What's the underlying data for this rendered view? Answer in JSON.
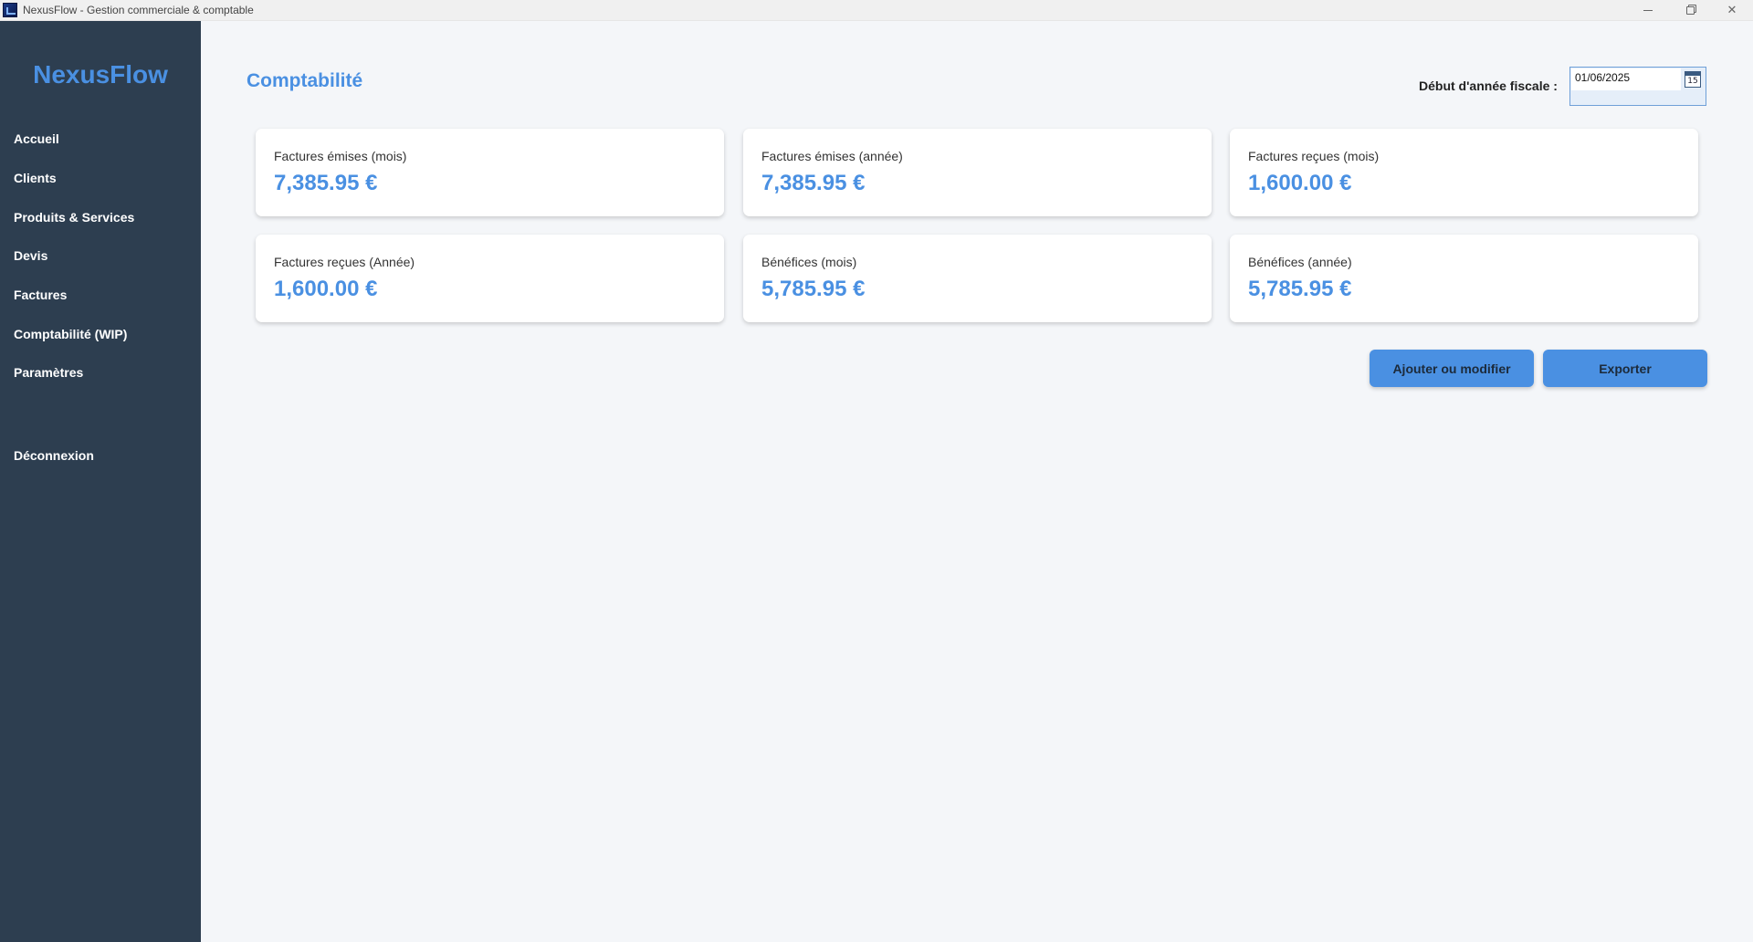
{
  "window": {
    "title": "NexusFlow - Gestion commerciale & comptable",
    "minimize_icon": "minimize-icon",
    "maximize_icon": "restore-icon",
    "close_glyph": "✕"
  },
  "sidebar": {
    "brand": "NexusFlow",
    "items": [
      {
        "label": "Accueil"
      },
      {
        "label": "Clients"
      },
      {
        "label": "Produits & Services"
      },
      {
        "label": "Devis"
      },
      {
        "label": "Factures"
      },
      {
        "label": "Comptabilité (WIP)"
      },
      {
        "label": "Paramètres"
      }
    ],
    "logout": "Déconnexion"
  },
  "header": {
    "title": "Comptabilité",
    "fiscal_label": "Début d'année fiscale :",
    "fiscal_date": "01/06/2025",
    "calendar_icon_text": "15"
  },
  "cards": [
    {
      "label": "Factures émises (mois)",
      "value": "7,385.95 €"
    },
    {
      "label": "Factures émises (année)",
      "value": "7,385.95 €"
    },
    {
      "label": "Factures reçues (mois)",
      "value": "1,600.00 €"
    },
    {
      "label": "Factures reçues (Année)",
      "value": "1,600.00 €"
    },
    {
      "label": "Bénéfices (mois)",
      "value": "5,785.95 €"
    },
    {
      "label": "Bénéfices (année)",
      "value": "5,785.95 €"
    }
  ],
  "actions": {
    "add_modify": "Ajouter ou modifier",
    "export": "Exporter"
  },
  "colors": {
    "accent": "#4a90e2",
    "sidebar_bg": "#2d3e50",
    "content_bg": "#f4f6f9"
  }
}
